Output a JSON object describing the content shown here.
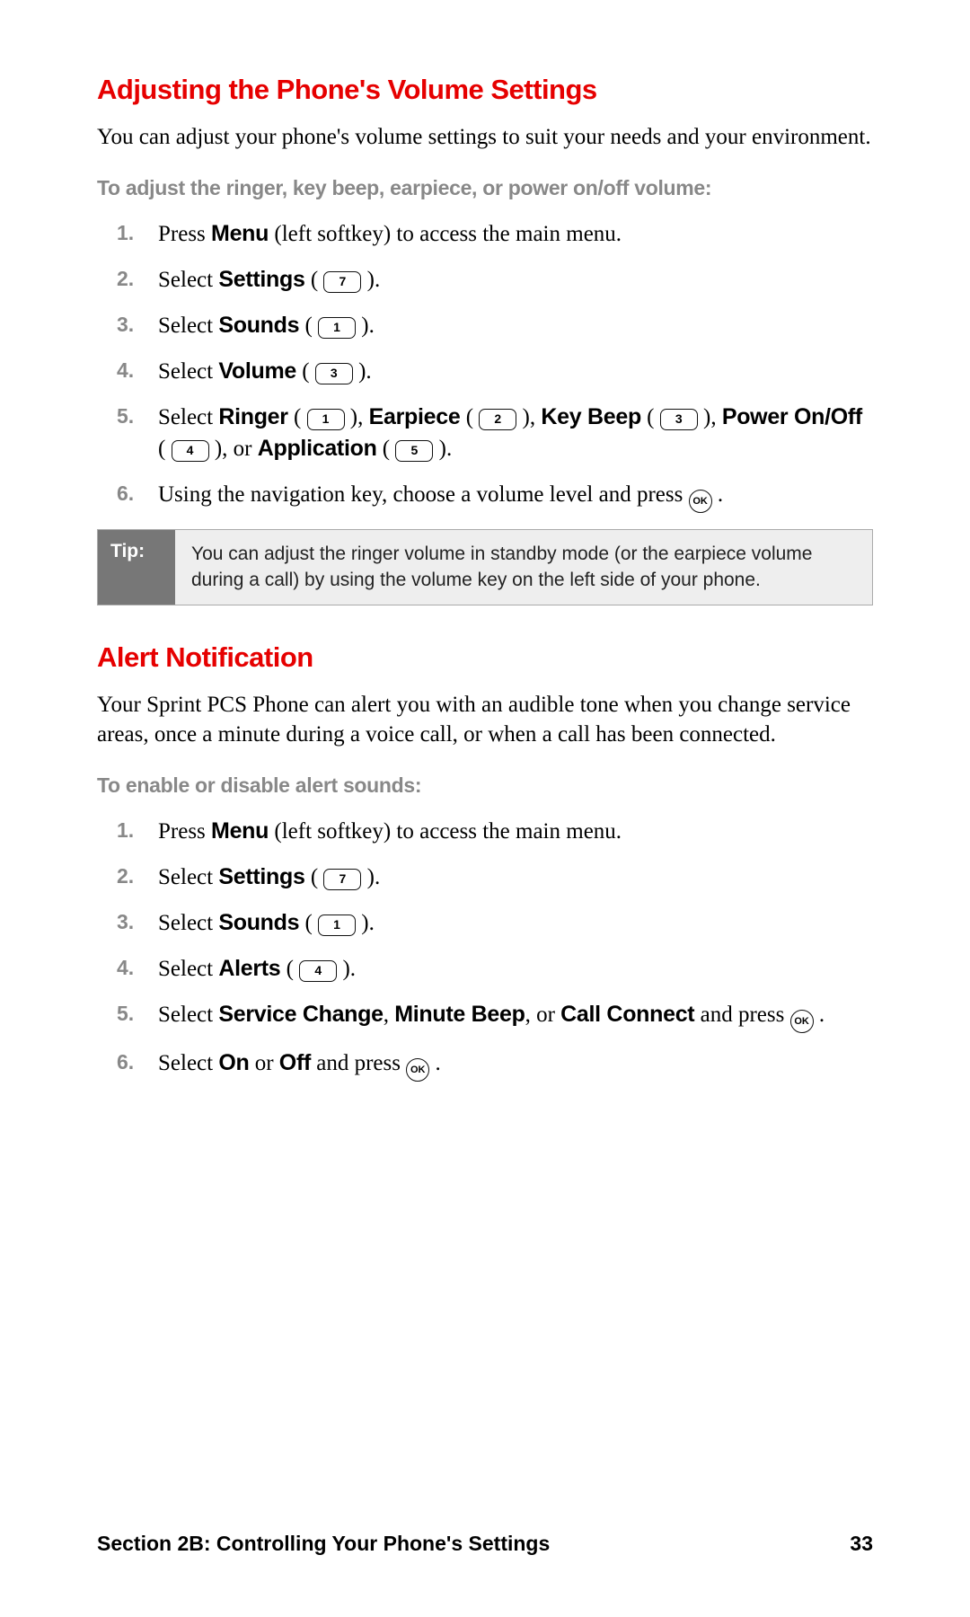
{
  "section1": {
    "heading": "Adjusting the Phone's Volume Settings",
    "intro": "You can adjust your phone's volume settings to suit your needs and your environment.",
    "subhead": "To adjust the ringer, key beep, earpiece, or power on/off volume:",
    "steps": {
      "s1a": "Press ",
      "s1b": "Menu",
      "s1c": " (left softkey) to access the main menu.",
      "s2a": "Select ",
      "s2b": "Settings",
      "s2c": " ( ",
      "s2key": "7",
      "s2d": " ).",
      "s3a": "Select ",
      "s3b": "Sounds",
      "s3c": " ( ",
      "s3key": "1",
      "s3d": " ).",
      "s4a": "Select ",
      "s4b": "Volume",
      "s4c": " ( ",
      "s4key": "3",
      "s4d": " ).",
      "s5a": "Select ",
      "s5b": "Ringer",
      "s5c": " ( ",
      "s5k1": "1",
      "s5d": " ), ",
      "s5e": "Earpiece",
      "s5f": " ( ",
      "s5k2": "2",
      "s5g": " ), ",
      "s5h": "Key Beep",
      "s5i": " ( ",
      "s5k3": "3",
      "s5j": " ), ",
      "s5k": "Power On/Off",
      "s5l": " ( ",
      "s5k4": "4",
      "s5m": " ), or ",
      "s5n": "Application",
      "s5o": " ( ",
      "s5k5": "5",
      "s5p": " ).",
      "s6a": "Using the navigation key, choose a volume level and press ",
      "s6ok": "OK",
      "s6b": " ."
    },
    "tip_label": "Tip:",
    "tip_text": "You can adjust the ringer volume in standby mode (or the earpiece volume during a call) by using the volume key on the left side of your phone."
  },
  "section2": {
    "heading": "Alert Notification",
    "intro": "Your Sprint PCS Phone can alert you with an audible tone when you change service areas, once a minute during a voice call, or when a call has been connected.",
    "subhead": "To enable or disable alert sounds:",
    "steps": {
      "s1a": "Press ",
      "s1b": "Menu",
      "s1c": " (left softkey) to access the main menu.",
      "s2a": "Select ",
      "s2b": "Settings",
      "s2c": " ( ",
      "s2key": "7",
      "s2d": " ).",
      "s3a": "Select ",
      "s3b": "Sounds",
      "s3c": " ( ",
      "s3key": "1",
      "s3d": " ).",
      "s4a": "Select ",
      "s4b": "Alerts",
      "s4c": " ( ",
      "s4key": "4",
      "s4d": " ).",
      "s5a": "Select ",
      "s5b": "Service Change",
      "s5c": ", ",
      "s5d": "Minute Beep",
      "s5e": ", or ",
      "s5f": "Call Connect",
      "s5g": " and press ",
      "s5ok": "OK",
      "s5h": " .",
      "s6a": "Select ",
      "s6b": "On",
      "s6c": " or ",
      "s6d": "Off",
      "s6e": " and press ",
      "s6ok": "OK",
      "s6f": " ."
    }
  },
  "footer": {
    "section": "Section 2B: Controlling Your Phone's Settings",
    "page": "33"
  }
}
